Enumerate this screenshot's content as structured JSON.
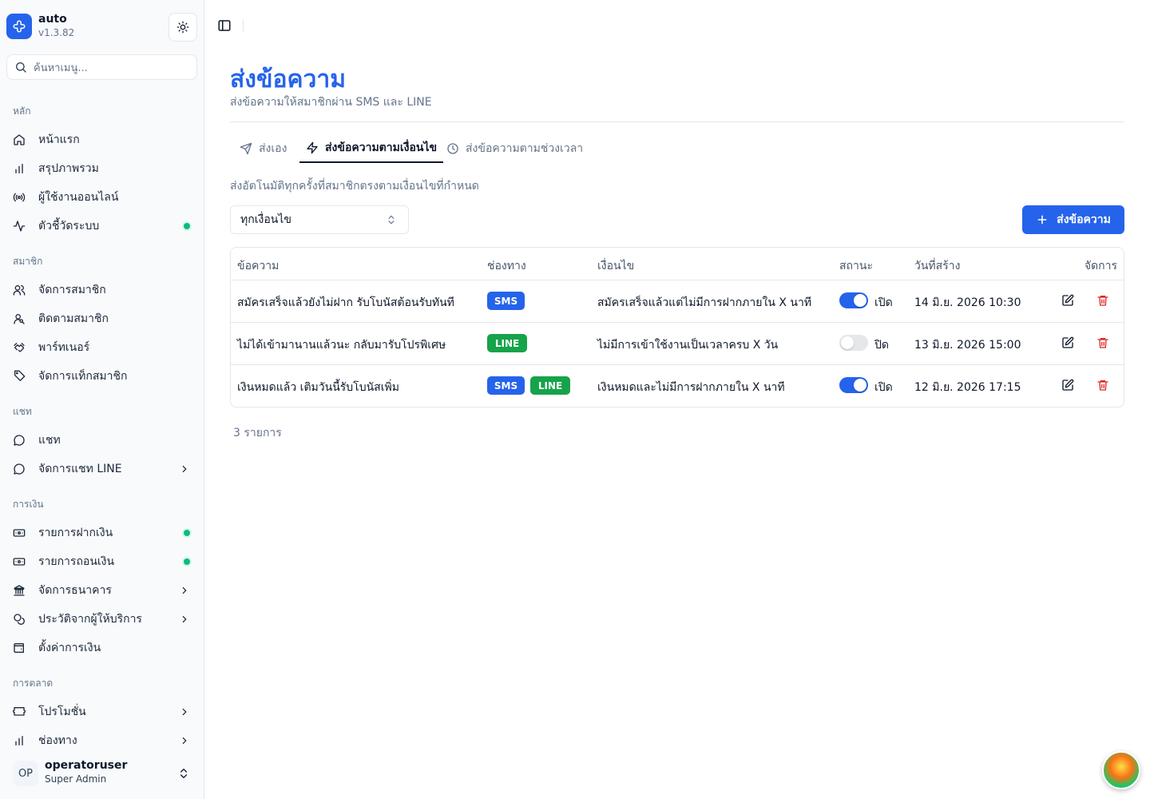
{
  "app": {
    "name": "auto",
    "version": "v1.3.82"
  },
  "search": {
    "placeholder": "ค้นหาเมนู..."
  },
  "sidebar": {
    "groups": [
      {
        "label": "หลัก",
        "items": [
          {
            "label": "หน้าแรก",
            "icon": "home-icon"
          },
          {
            "label": "สรุปภาพรวม",
            "icon": "bar-chart-icon"
          },
          {
            "label": "ผู้ใช้งานออนไลน์",
            "icon": "radio-icon"
          },
          {
            "label": "ตัวชี้วัดระบบ",
            "icon": "activity-icon",
            "dot": true
          }
        ]
      },
      {
        "label": "สมาชิก",
        "items": [
          {
            "label": "จัดการสมาชิก",
            "icon": "users-icon"
          },
          {
            "label": "ติดตามสมาชิก",
            "icon": "user-search-icon"
          },
          {
            "label": "พาร์ทเนอร์",
            "icon": "handshake-icon"
          },
          {
            "label": "จัดการแท็กสมาชิก",
            "icon": "tag-icon"
          }
        ]
      },
      {
        "label": "แชท",
        "items": [
          {
            "label": "แชท",
            "icon": "message-circle-icon"
          },
          {
            "label": "จัดการแชท LINE",
            "icon": "message-circle-icon",
            "chevron": true
          }
        ]
      },
      {
        "label": "การเงิน",
        "items": [
          {
            "label": "รายการฝากเงิน",
            "icon": "deposit-icon",
            "dot": true
          },
          {
            "label": "รายการถอนเงิน",
            "icon": "withdraw-icon",
            "dot": true
          },
          {
            "label": "จัดการธนาคาร",
            "icon": "bank-icon",
            "chevron": true
          },
          {
            "label": "ประวัติจากผู้ให้บริการ",
            "icon": "coins-icon",
            "chevron": true
          },
          {
            "label": "ตั้งค่าการเงิน",
            "icon": "wallet-icon"
          }
        ]
      },
      {
        "label": "การตลาด",
        "items": [
          {
            "label": "โปรโมชั่น",
            "icon": "ticket-icon",
            "chevron": true
          },
          {
            "label": "ช่องทาง",
            "icon": "bar-chart-icon",
            "chevron": true
          }
        ]
      }
    ]
  },
  "user": {
    "initials": "OP",
    "name": "operatoruser",
    "role": "Super Admin"
  },
  "page": {
    "title": "ส่งข้อความ",
    "subtitle": "ส่งข้อความให้สมาชิกผ่าน SMS และ LINE",
    "tabs": [
      "ส่งเอง",
      "ส่งข้อความตามเงื่อนไข",
      "ส่งข้อความตามช่วงเวลา"
    ],
    "description": "ส่งอัตโนมัติทุกครั้งที่สมาชิกตรงตามเงื่อนไขที่กำหนด",
    "filter_value": "ทุกเงื่อนไข",
    "primary_button": "ส่งข้อความ"
  },
  "table": {
    "headers": [
      "ข้อความ",
      "ช่องทาง",
      "เงื่อนไข",
      "สถานะ",
      "วันที่สร้าง",
      "จัดการ"
    ],
    "rows": [
      {
        "message": "สมัครเสร็จแล้วยังไม่ฝาก รับโบนัสต้อนรับทันที",
        "channels": [
          "SMS"
        ],
        "condition": "สมัครเสร็จแล้วแต่ไม่มีการฝากภายใน X นาที",
        "enabled": true,
        "status": "เปิด",
        "created": "14 มิ.ย. 2026 10:30"
      },
      {
        "message": "ไม่ได้เข้ามานานแล้วนะ กลับมารับโปรพิเศษ",
        "channels": [
          "LINE"
        ],
        "condition": "ไม่มีการเข้าใช้งานเป็นเวลาครบ X วัน",
        "enabled": false,
        "status": "ปิด",
        "created": "13 มิ.ย. 2026 15:00"
      },
      {
        "message": "เงินหมดแล้ว เติมวันนี้รับโบนัสเพิ่ม",
        "channels": [
          "SMS",
          "LINE"
        ],
        "condition": "เงินหมดและไม่มีการฝากภายใน X นาที",
        "enabled": true,
        "status": "เปิด",
        "created": "12 มิ.ย. 2026 17:15"
      }
    ],
    "count_label": "3 รายการ"
  },
  "colors": {
    "accent": "#2563eb",
    "sms": "#2563eb",
    "line": "#16a34a",
    "danger": "#dc2626",
    "online_dot": "#10b981"
  }
}
